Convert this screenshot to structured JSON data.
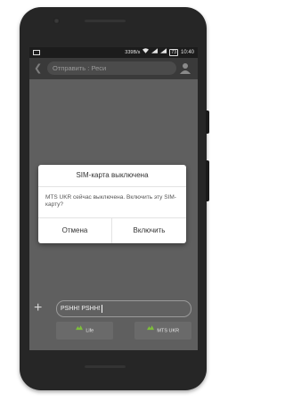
{
  "status_bar": {
    "speed": "339B/s",
    "battery": "73",
    "time": "10:40"
  },
  "header": {
    "recipient_placeholder": "Отправить : Реси"
  },
  "dialog": {
    "title": "SIM-карта выключена",
    "message": "MTS UKR сейчас выключена. Включить эту SIM-карту?",
    "cancel_label": "Отмена",
    "confirm_label": "Включить"
  },
  "compose": {
    "value": "PSHH! PSHH!"
  },
  "sim_buttons": [
    {
      "label": "Life"
    },
    {
      "label": "MTS UKR"
    }
  ],
  "colors": {
    "sim_icon": "#7ec03a",
    "screen_bg": "#5f5f5f"
  }
}
